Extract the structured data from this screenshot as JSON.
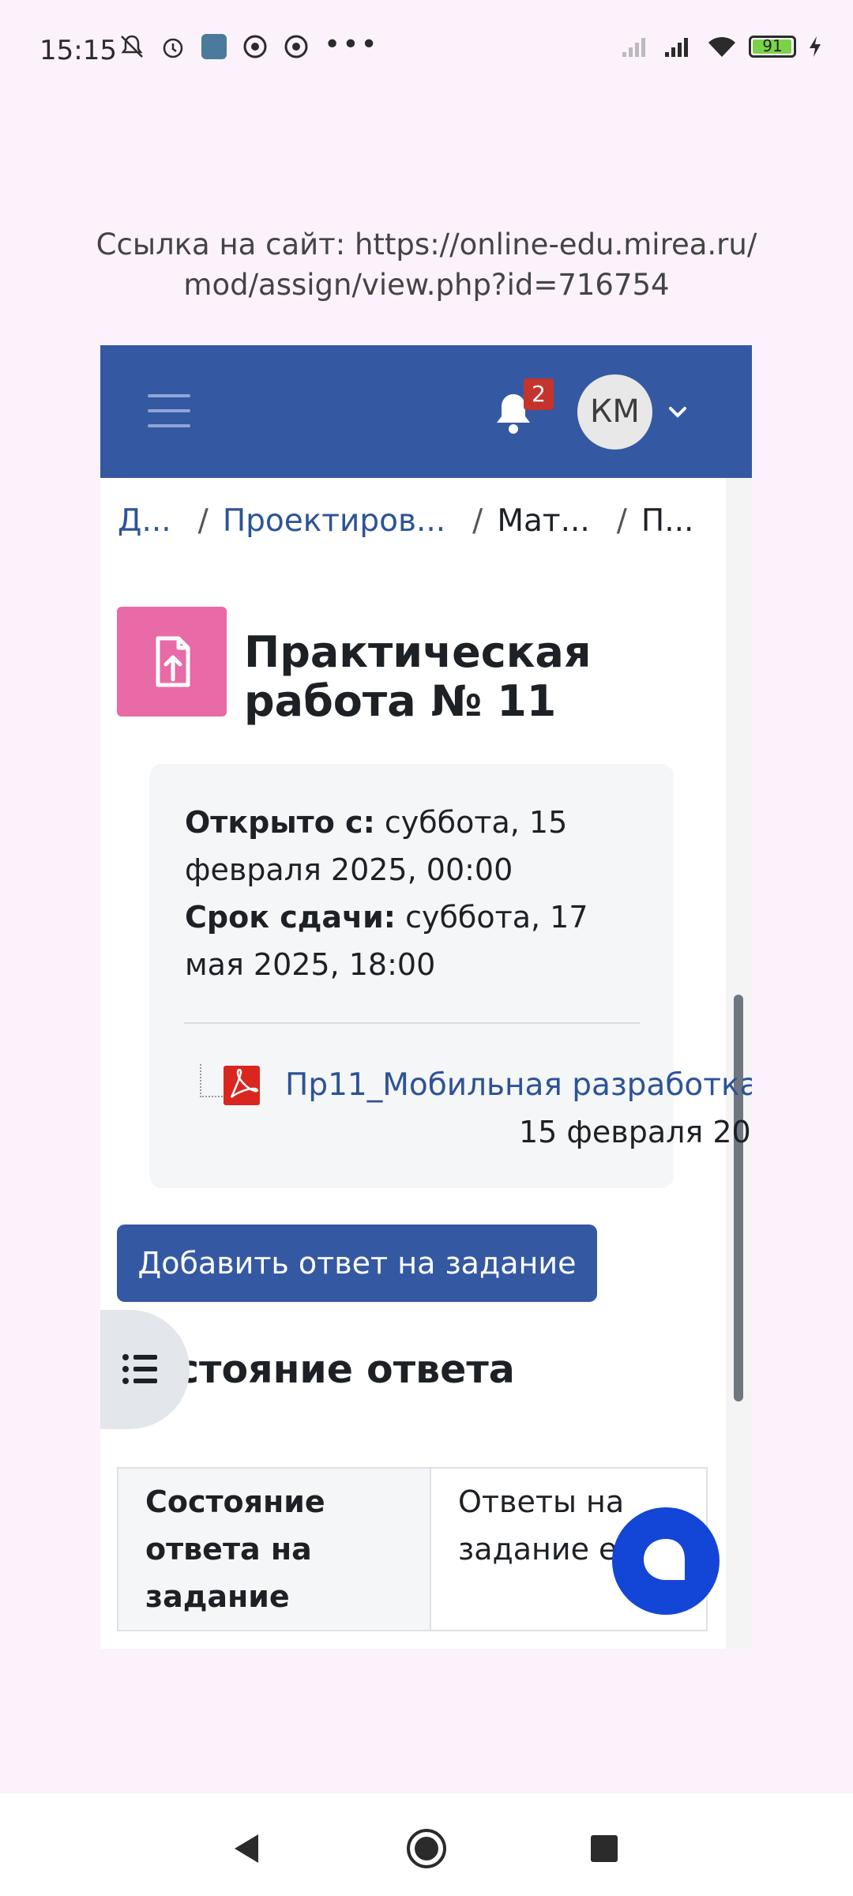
{
  "status_bar": {
    "time": "15:15",
    "icons": [
      "mute-bell-icon",
      "alarm-icon",
      "gallery-icon",
      "app-icon",
      "app-icon",
      "more-dots-icon"
    ],
    "more": "•••",
    "battery": "91",
    "right_icons": [
      "no-signal-icon",
      "signal-icon",
      "wifi-icon",
      "battery-icon",
      "charging-icon"
    ]
  },
  "url_caption": "Ссылка на сайт: https://online-edu.mirea.ru/mod/assign/view.php?id=716754",
  "topbar": {
    "notifications_count": "2",
    "avatar_initials": "КМ"
  },
  "breadcrumb": {
    "items": [
      "Д...",
      "Проектиров...",
      "Мат...",
      "П..."
    ],
    "separator": "/"
  },
  "page_title": "Практическая работа № 11",
  "dates": {
    "open_label": "Открыто с:",
    "open_value": " суббота, 15 февраля 2025, 00:00",
    "due_label": "Срок сдачи:",
    "due_value": " суббота, 17 мая 2025, 18:00"
  },
  "attachment": {
    "name": "Пр11_Мобильная разработка",
    "date": "15 февраля 20"
  },
  "submit_button": "Добавить ответ на задание",
  "section_title": "стояние ответа",
  "status_table": {
    "header": "Состояние ответа на задание",
    "value": "Ответы на задание е не"
  },
  "colors": {
    "navbar": "#3558a3",
    "link": "#2d5397",
    "activity_icon": "#e86aa6",
    "chat_button": "#1346d6"
  }
}
